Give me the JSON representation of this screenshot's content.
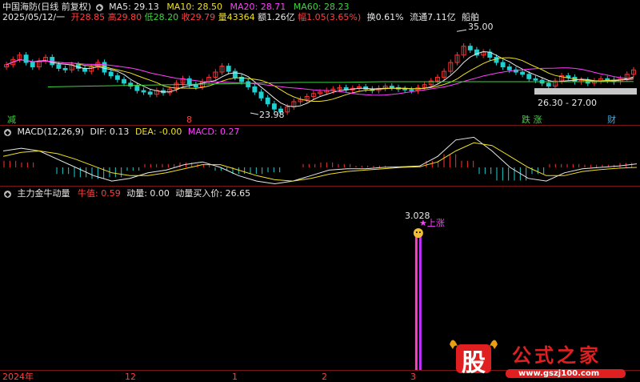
{
  "header": {
    "security": "中国海防(日线 前复权)",
    "ma5": "MA5: 29.13",
    "ma10": "MA10: 28.50",
    "ma20": "MA20: 28.71",
    "ma60": "MA60: 28.23",
    "date": "2025/05/12/一",
    "open": "开28.85",
    "high": "高29.80",
    "low": "低28.20",
    "close": "收29.79",
    "volume": "量43364",
    "amount": "额1.26亿",
    "change": "幅1.05(3.65%)",
    "turnover": "换0.61%",
    "float": "流通7.11亿",
    "industry": "船舶"
  },
  "main_panel": {
    "high_label": "35.00",
    "low_label": "23.98",
    "range_label": "26.30 - 27.00",
    "markers": [
      "减",
      "8",
      "跌 涨",
      "财"
    ]
  },
  "macd_panel": {
    "name": "MACD(12,26,9)",
    "dif": "DIF: 0.13",
    "dea": "DEA: -0.00",
    "macd": "MACD: 0.27"
  },
  "signal_panel": {
    "name": "主力金牛动量",
    "niu_label": "牛值:",
    "niu_value": "0.59",
    "momentum": "动量: 0.00",
    "buy_price": "动量买入价: 26.65",
    "peak_value": "3.028",
    "signal_text": "★上涨"
  },
  "x_axis": [
    "2024年",
    "12",
    "1",
    "2",
    "3"
  ],
  "watermark": {
    "brand": "股",
    "name": "公式之家",
    "url": "www.gszj100.com"
  },
  "colors": {
    "up": "#ff3030",
    "down": "#20d0d0",
    "ma5": "#e8e8e8",
    "ma10": "#f0e020",
    "ma20": "#ff40ff",
    "ma60": "#3fd33f",
    "separator": "#7a1515"
  },
  "chart_data": [
    {
      "type": "candlestick",
      "title": "中国海防(日线 前复权)",
      "ylim": [
        23,
        36
      ],
      "x": [
        "2024年",
        "12",
        "1",
        "2",
        "3"
      ],
      "closes": [
        30.5,
        31.2,
        31.8,
        30.8,
        30.2,
        31.0,
        31.5,
        30.5,
        30.0,
        29.8,
        30.5,
        30.0,
        29.6,
        30.2,
        30.8,
        29.5,
        29.0,
        28.5,
        28.0,
        27.6,
        27.0,
        26.8,
        26.5,
        27.0,
        26.7,
        27.2,
        28.0,
        28.6,
        27.8,
        27.5,
        28.2,
        28.8,
        29.5,
        30.3,
        29.6,
        28.8,
        28.2,
        27.5,
        26.8,
        26.0,
        25.2,
        24.5,
        24.1,
        24.8,
        25.5,
        25.8,
        26.2,
        26.6,
        26.8,
        27.0,
        27.2,
        27.4,
        27.1,
        27.3,
        27.5,
        27.2,
        27.0,
        27.3,
        27.6,
        27.4,
        27.2,
        27.1,
        27.0,
        27.4,
        27.8,
        28.3,
        28.8,
        29.6,
        30.8,
        31.8,
        33.0,
        32.5,
        31.8,
        32.2,
        31.5,
        30.8,
        30.2,
        29.8,
        29.5,
        29.2,
        28.6,
        28.4,
        28.0,
        27.6,
        28.3,
        29.0,
        28.8,
        28.2,
        28.4,
        28.0,
        28.3,
        28.6,
        28.4,
        28.2,
        28.6,
        29.2,
        29.79
      ],
      "ma5": [
        30.8,
        31.2,
        30.8,
        30.3,
        30.6,
        30.4,
        30.0,
        29.8,
        28.8,
        28.0,
        27.4,
        26.9,
        27.2,
        28.0,
        28.3,
        28.6,
        29.4,
        28.7,
        27.6,
        26.3,
        24.9,
        24.8,
        25.6,
        26.4,
        26.9,
        27.2,
        27.2,
        27.3,
        27.2,
        27.1,
        27.2,
        27.1,
        27.9,
        29.6,
        31.8,
        32.3,
        31.6,
        30.4,
        29.6,
        28.8,
        28.1,
        28.4,
        28.6,
        28.3,
        28.3,
        28.5,
        28.8,
        29.13
      ],
      "ma60": [
        27.5,
        27.6,
        27.7,
        27.8,
        27.9,
        28.0,
        28.1,
        28.1,
        28.2,
        28.2,
        28.2,
        28.2,
        28.2,
        28.2,
        28.23
      ],
      "low_marker": 23.98,
      "high_marker": 35.0,
      "range_box": [
        26.3,
        27.0
      ]
    },
    {
      "type": "line",
      "title": "MACD(12,26,9)",
      "series": [
        {
          "name": "DIF",
          "values": [
            0.6,
            0.7,
            0.6,
            0.3,
            0.0,
            -0.3,
            -0.5,
            -0.4,
            -0.2,
            -0.1,
            0.1,
            0.2,
            0.0,
            -0.3,
            -0.5,
            -0.6,
            -0.5,
            -0.3,
            -0.1,
            -0.05,
            -0.05,
            0.0,
            0.02,
            0.05,
            0.4,
            1.0,
            1.1,
            0.6,
            0.0,
            -0.4,
            -0.5,
            -0.2,
            -0.05,
            0.0,
            0.05,
            0.13
          ]
        },
        {
          "name": "DEA",
          "values": [
            0.4,
            0.55,
            0.6,
            0.5,
            0.3,
            0.05,
            -0.2,
            -0.3,
            -0.3,
            -0.2,
            -0.05,
            0.1,
            0.1,
            -0.1,
            -0.3,
            -0.45,
            -0.5,
            -0.4,
            -0.25,
            -0.15,
            -0.1,
            -0.05,
            0.0,
            0.02,
            0.2,
            0.6,
            0.9,
            0.8,
            0.4,
            0.0,
            -0.3,
            -0.3,
            -0.15,
            -0.08,
            -0.03,
            0.0
          ]
        }
      ],
      "histogram": [
        0.4,
        0.3,
        0.0,
        -0.4,
        -0.6,
        -0.7,
        -0.6,
        -0.2,
        0.2,
        0.2,
        0.3,
        0.2,
        -0.2,
        -0.4,
        -0.4,
        -0.3,
        0.0,
        0.2,
        0.3,
        0.2,
        0.1,
        0.1,
        0.05,
        0.06,
        0.4,
        0.8,
        0.4,
        -0.4,
        -0.8,
        -0.8,
        -0.4,
        0.2,
        0.2,
        0.16,
        0.16,
        0.27
      ]
    },
    {
      "type": "bar",
      "title": "主力金牛动量",
      "peak": 3.028,
      "signal_index": 0.64
    }
  ]
}
